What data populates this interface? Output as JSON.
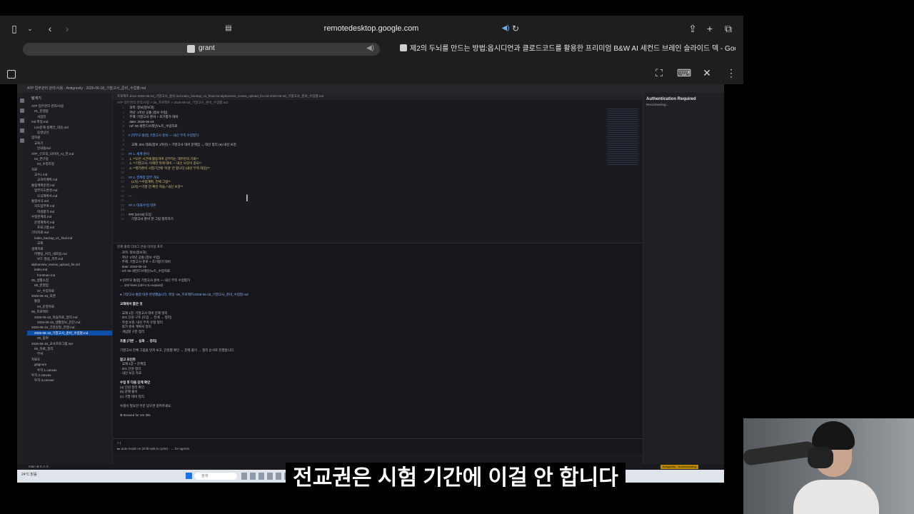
{
  "browser": {
    "url": "remotedesktop.google.com",
    "active_tab": "grant",
    "second_tab": "제2의 두뇌를 만드는 방법:옵시디언과 클로드코드를 활용한 프리미엄 B&W AI 세컨드 브레인 슬라이드 덱 - Google Slides"
  },
  "ide": {
    "title_bar": "ATP 업무관리 관리/사용 · Antigravity · 2026-06-18_기말고사_준비_수업평.md",
    "explorer_title": "탐색기",
    "tree": [
      "ATP 업무관리 관리/사용",
      "01_진행중",
      "사업진",
      "md 파일.md",
      "Ltrs문해 설계안_대응.md",
      "동영상선",
      "업자원",
      "교육기",
      "인내들md",
      "ATP_구조의_되어어_AI_연.md",
      "03_연구용",
      "04_수정조정",
      "자료",
      "교수1.md",
      "교과목계획.md",
      "통합계획운영.md",
      "업무지도변경.md",
      "오곡계획서.md",
      "통합서식.md",
      "지도업부여.md",
      "학생평가.md",
      "수정관계의.md",
      "운영계획서.md",
      "프로그램.md",
      "기타자료.md",
      "index_backup_v1_final.md",
      "교재",
      "설계자료",
      "마켓팅_커리_새로움.md",
      "보드 정섬_리뷰.md",
      "alpharview_review_upload_fin.md",
      "index.md",
      "frontman.md",
      "05_생활소집",
      "08_반영업",
      "07_수업자료",
      "2026-06-16_의견",
      "통합",
      "04_운영자료",
      "06_프로젝트",
      "2026-06-18_학습자료_정리.md",
      "2026-06-18_생활정보_진단.md",
      "2026-06-19_건강일정_진행.md",
      "2026-06-18_기말고사_준비_수업평.md",
      "09_참여",
      "2026-06-16_교사프로그램.md",
      "05_자료_정리",
      "부서",
      "자료도",
      "gitignore",
      "투자 1.canvas",
      "투자 2.canvas",
      "투자 3.canvas"
    ],
    "selected_index": 43,
    "editor_tabs": "프로젝트.docx   2026-06-18_기말고사_준비.md   index_backup_v1_final.md   alpharview_review_upload_fin.md   2026-06-18_기말고사_준비_수업평.md",
    "breadcrumb": "ATP 업무관리 관리/사용 > 06_프로젝트 > 2026-06-18_기말고사_준비_수업평.md",
    "code": [
      {
        "t": "  과목: 정보(정보과)",
        "c": "text"
      },
      {
        "t": "  학년: 1학년 공통 (정보 수업)",
        "c": "text"
      },
      {
        "t": "  주제: 기말고사 준비 + 조기평가 대비",
        "c": "text"
      },
      {
        "t": "  date: 2026-06-18",
        "c": "text"
      },
      {
        "t": "  ref: 00 세컨드브레인/노트_수업자료",
        "c": "text"
      },
      {
        "t": "",
        "c": "text"
      },
      {
        "t": "# [학부모 통합] 기말고사 준비 — 내신 부족 수업평가",
        "c": "head"
      },
      {
        "t": "",
        "c": "text"
      },
      {
        "t": "  · 교재: 001 대표(정보 1학년) + 기말고사 대비 문제집 → 대신 정리 (●) 내신 보강",
        "c": "text"
      },
      {
        "t": "",
        "c": "text"
      },
      {
        "t": "## 1. 세계 준비",
        "c": "head"
      },
      {
        "t": "  1. **모든 시간에 활동하며 공부하는 대부분의 기회**",
        "c": "yel"
      },
      {
        "t": "  2. **기말고사, 이해한 뒤에 대비 — 내신 보강이 중요**",
        "c": "yel"
      },
      {
        "t": "  3. **평가준비 시험기간에 '이걸' 안 합니다 (내신 부족 대응)**",
        "c": "yel"
      },
      {
        "t": "",
        "c": "text"
      },
      {
        "t": "## 2. 전체정 업무 개요",
        "c": "head"
      },
      {
        "t": "  · (1차) **수업계획, 전체 그림**",
        "c": "yel"
      },
      {
        "t": "  · (2차) **기말 전 확인 학습 / 내신 보강**",
        "c": "yel"
      },
      {
        "t": "",
        "c": "text"
      },
      {
        "t": "---",
        "c": "text"
      },
      {
        "t": "",
        "c": "text"
      },
      {
        "t": "## 3. 대화/수업 대본",
        "c": "head"
      },
      {
        "t": "",
        "c": "text"
      },
      {
        "t": "### [10:00] 도입",
        "c": "text"
      },
      {
        "t": "  · 기말고사 준비 한 그림 정리하기",
        "c": "text"
      }
    ],
    "terminal_tabs": "문제   출력   디버그 콘솔   터미널   포트",
    "terminal": [
      {
        "t": "  · 과목: 정보(정보과)",
        "c": "n"
      },
      {
        "t": "  · 학년: 1학년 공통 (정보 수업)",
        "c": "n"
      },
      {
        "t": "  · 주제: 기말고사 준비 + 조기평가 대비",
        "c": "n"
      },
      {
        "t": "  · date: 2026-06-18",
        "c": "n"
      },
      {
        "t": "  · ref: 00 세컨드브레인/노트_수업자료",
        "c": "n"
      },
      {
        "t": "",
        "c": "n"
      },
      {
        "t": "  # [학부모 통합] 기말고사 준비 — 내신 부족 수업평가",
        "c": "n"
      },
      {
        "t": "  … 102 lines (ctrl+o to expand)",
        "c": "n"
      },
      {
        "t": "",
        "c": "n"
      },
      {
        "t": "● 기말고사 통합 대본 완성했습니다. 파일: 06_프로젝트/2026-06-18_기말고사_준비_수업평.md",
        "c": "blue"
      },
      {
        "t": "",
        "c": "n"
      },
      {
        "t": "  교재에서 뽑은 것",
        "c": "hi"
      },
      {
        "t": "",
        "c": "n"
      },
      {
        "t": "  · 교재 1장: 기말고사 대비 문제 정리",
        "c": "n"
      },
      {
        "t": "  · 001 단원 구조 (도입 → 전개 → 정리)",
        "c": "n"
      },
      {
        "t": "  · 학생 보충: 내신 부족 유형 정리",
        "c": "n"
      },
      {
        "t": "  · 평가 준비 계획서 정리",
        "c": "n"
      },
      {
        "t": "  · 개념별 구분 정리",
        "c": "n"
      },
      {
        "t": "",
        "c": "n"
      },
      {
        "t": "  흐름 (기본 → 심화 → 정리)",
        "c": "hi"
      },
      {
        "t": "",
        "c": "n"
      },
      {
        "t": "  기말고사 전체 그림을 먼저 보고, 단원별 확인 → 문제 풀이 → 정리 순서로 진행합니다.",
        "c": "n"
      },
      {
        "t": "",
        "c": "n"
      },
      {
        "t": "  참고 포인트",
        "c": "hi"
      },
      {
        "t": "  · 교재 1장 + 문제집",
        "c": "n"
      },
      {
        "t": "  · 001 단원 정리",
        "c": "n"
      },
      {
        "t": "  · 내신 보강 자료",
        "c": "n"
      },
      {
        "t": "",
        "c": "n"
      },
      {
        "t": "  수업 후 다음 단계 확인",
        "c": "hi"
      },
      {
        "t": "  (a) 단원 정리 확인",
        "c": "n"
      },
      {
        "t": "  (b) 문제 풀이",
        "c": "n"
      },
      {
        "t": "  (c) 기말 대비 정리",
        "c": "n"
      },
      {
        "t": "",
        "c": "n"
      },
      {
        "t": "  수정이 필요한 부분 있으면 알려주세요.",
        "c": "n"
      },
      {
        "t": "",
        "c": "n"
      },
      {
        "t": "  ✻ Brewed for 2m 39s",
        "c": "n"
      }
    ],
    "prompt": "> |",
    "prompt_hint": "▸▸ auto mode on (shift+tab to cycle) · ← for agents",
    "auth_title": "Authentication Required",
    "auth_sub": "Reconnecting...",
    "status_left": "main ⊗ 0 ⚠ 0",
    "status_badge": "Antigravity · Authenticating",
    "taskbar_weather": "24°C 맑음",
    "taskbar_search": "검색"
  },
  "subtitle": "전교권은 시험 기간에 이걸 안 합니다"
}
